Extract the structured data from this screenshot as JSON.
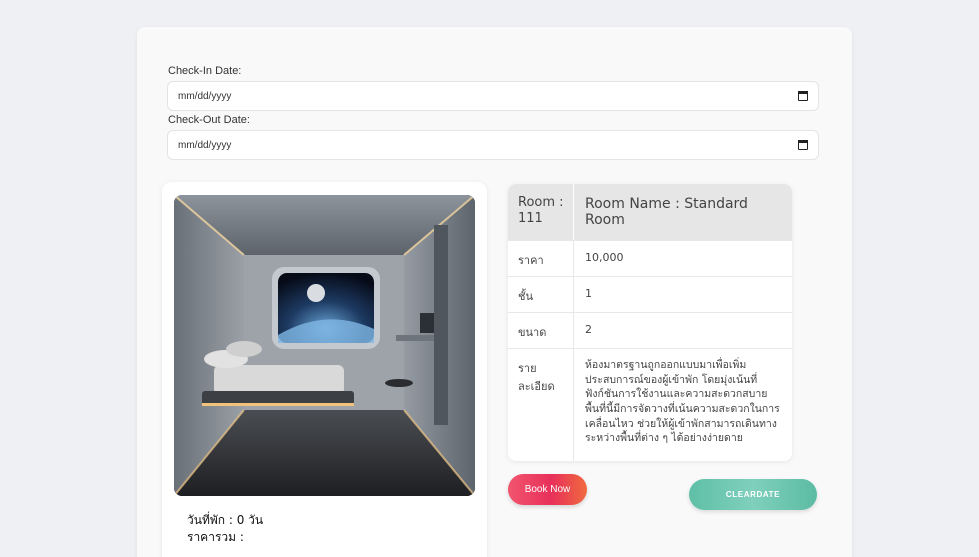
{
  "form": {
    "checkin_label": "Check-In Date:",
    "checkin_placeholder": "mm/dd/yyyy",
    "checkout_label": "Check-Out Date:",
    "checkout_placeholder": "mm/dd/yyyy"
  },
  "room": {
    "number_label": "Room : 111",
    "name_label": "Room Name : Standard Room",
    "rows": [
      {
        "key": "ราคา",
        "value": "10,000"
      },
      {
        "key": "ชั้น",
        "value": "1"
      },
      {
        "key": "ขนาด",
        "value": "2"
      },
      {
        "key": "ราย ละเอียด",
        "value": "ห้องมาตรฐานถูกออกแบบมาเพื่อเพิ่มประสบการณ์ของผู้เข้าพัก โดยมุ่งเน้นที่ฟังก์ชันการใช้งานและความสะดวกสบาย พื้นที่นี้มีการจัดวางที่เน้นความสะดวกในการเคลื่อนไหว ช่วยให้ผู้เข้าพักสามารถเดินทางระหว่างพื้นที่ต่าง ๆ ได้อย่างง่ายดาย"
      }
    ]
  },
  "summary": {
    "nights": "วันที่พัก : 0 วัน",
    "total": "ราคารวม :"
  },
  "actions": {
    "book_label": "Book Now",
    "clear_label": "CLEARDATE"
  },
  "colors": {
    "book_accent": "#e8305a",
    "clear_accent": "#6cc8b1"
  }
}
